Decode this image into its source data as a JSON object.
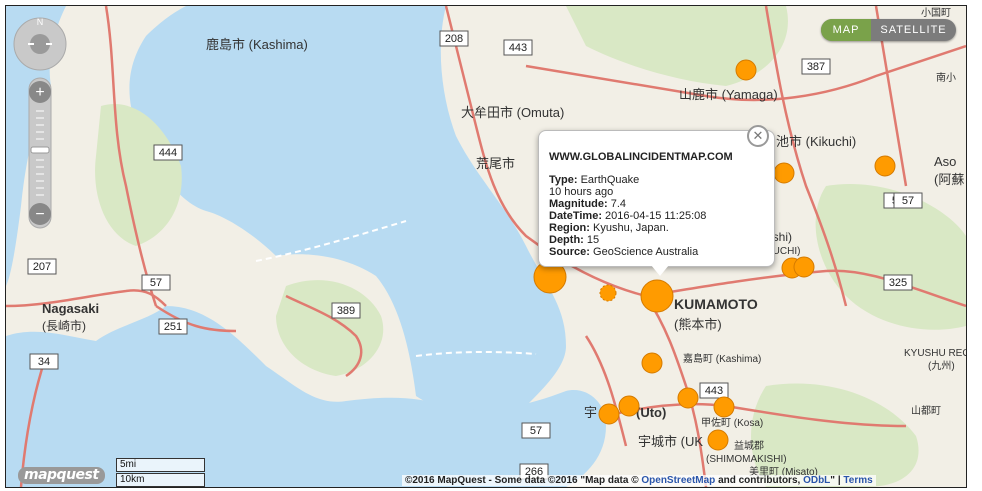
{
  "map": {
    "toggle": {
      "map_label": "MAP",
      "satellite_label": "SATELLITE",
      "active": "MAP"
    },
    "compass": {
      "north_label": "N"
    },
    "colors": {
      "water": "#b8dbf2",
      "land": "#f2efe6",
      "green": "#d9e8c5",
      "road": "#e07a70",
      "marker": "#ff9b00",
      "marker_stroke": "#d47a00"
    },
    "places": [
      {
        "label": "鹿島市 (Kashima)"
      },
      {
        "label": "大牟田市 (Omuta)"
      },
      {
        "label": "山鹿市 (Yamaga)"
      },
      {
        "label": "池市 (Kikuchi)"
      },
      {
        "label": "荒尾市"
      },
      {
        "label": "Aso"
      },
      {
        "label": "(阿蘇"
      },
      {
        "label": "oshi)"
      },
      {
        "label": "KUCHI)"
      },
      {
        "label": "Nagasaki"
      },
      {
        "label": "(長崎市)"
      },
      {
        "label": "KUMAMOTO"
      },
      {
        "label": "(熊本市)"
      },
      {
        "label": "嘉島町 (Kashima)"
      },
      {
        "label": "宇"
      },
      {
        "label": "(Uto)"
      },
      {
        "label": "宇城市 (UK"
      },
      {
        "label": "甲佐町 (Kosa)"
      },
      {
        "label": "益城郡"
      },
      {
        "label": "(SHIMOMAKISHI)"
      },
      {
        "label": "美里町 (Misato)"
      },
      {
        "label": "山都町"
      },
      {
        "label": "KYUSHU REG"
      },
      {
        "label": "(九州)"
      },
      {
        "label": "小国町"
      },
      {
        "label": "南小"
      }
    ],
    "road_shields": [
      "208",
      "443",
      "387",
      "444",
      "57",
      "207",
      "57",
      "251",
      "389",
      "34",
      "57",
      "325",
      "443",
      "57",
      "266"
    ],
    "markers": [
      {
        "lat_label": "Yamaga area",
        "size": "medium"
      },
      {
        "lat_label": "Aso area",
        "size": "medium"
      },
      {
        "lat_label": "Kikuchi area",
        "size": "medium"
      },
      {
        "lat_label": "Oshi area 1",
        "size": "medium"
      },
      {
        "lat_label": "Oshi area 2",
        "size": "medium"
      },
      {
        "lat_label": "Coast",
        "size": "large"
      },
      {
        "lat_label": "West Kumamoto",
        "size": "small"
      },
      {
        "lat_label": "Kumamoto",
        "size": "large"
      },
      {
        "lat_label": "Kashima",
        "size": "medium"
      },
      {
        "lat_label": "South 1",
        "size": "medium"
      },
      {
        "lat_label": "Uto 1",
        "size": "medium"
      },
      {
        "lat_label": "Uto 2",
        "size": "medium"
      },
      {
        "lat_label": "Kosa",
        "size": "medium"
      },
      {
        "lat_label": "Uki",
        "size": "medium"
      }
    ]
  },
  "popup": {
    "header": "WWW.GLOBALINCIDENTMAP.COM",
    "fields": [
      {
        "label": "Type:",
        "value": "EarthQuake"
      },
      {
        "label": "",
        "value": "10 hours ago"
      },
      {
        "label": "Magnitude:",
        "value": "7.4"
      },
      {
        "label": "DateTime:",
        "value": "2016-04-15 11:25:08"
      },
      {
        "label": "Region:",
        "value": "Kyushu, Japan."
      },
      {
        "label": "Depth:",
        "value": "15"
      },
      {
        "label": "Source:",
        "value": "GeoScience Australia"
      }
    ],
    "close_icon": "close-icon"
  },
  "scale": {
    "miles": "5mi",
    "km": "10km"
  },
  "logo": "mapquest",
  "attribution": {
    "part1": "©2016 MapQuest - Some data ©2016 \"Map data ©",
    "osm": "OpenStreetMap",
    "part2": "and contributors,",
    "odbl": "ODbL",
    "sep": "\" |",
    "terms": "Terms"
  }
}
